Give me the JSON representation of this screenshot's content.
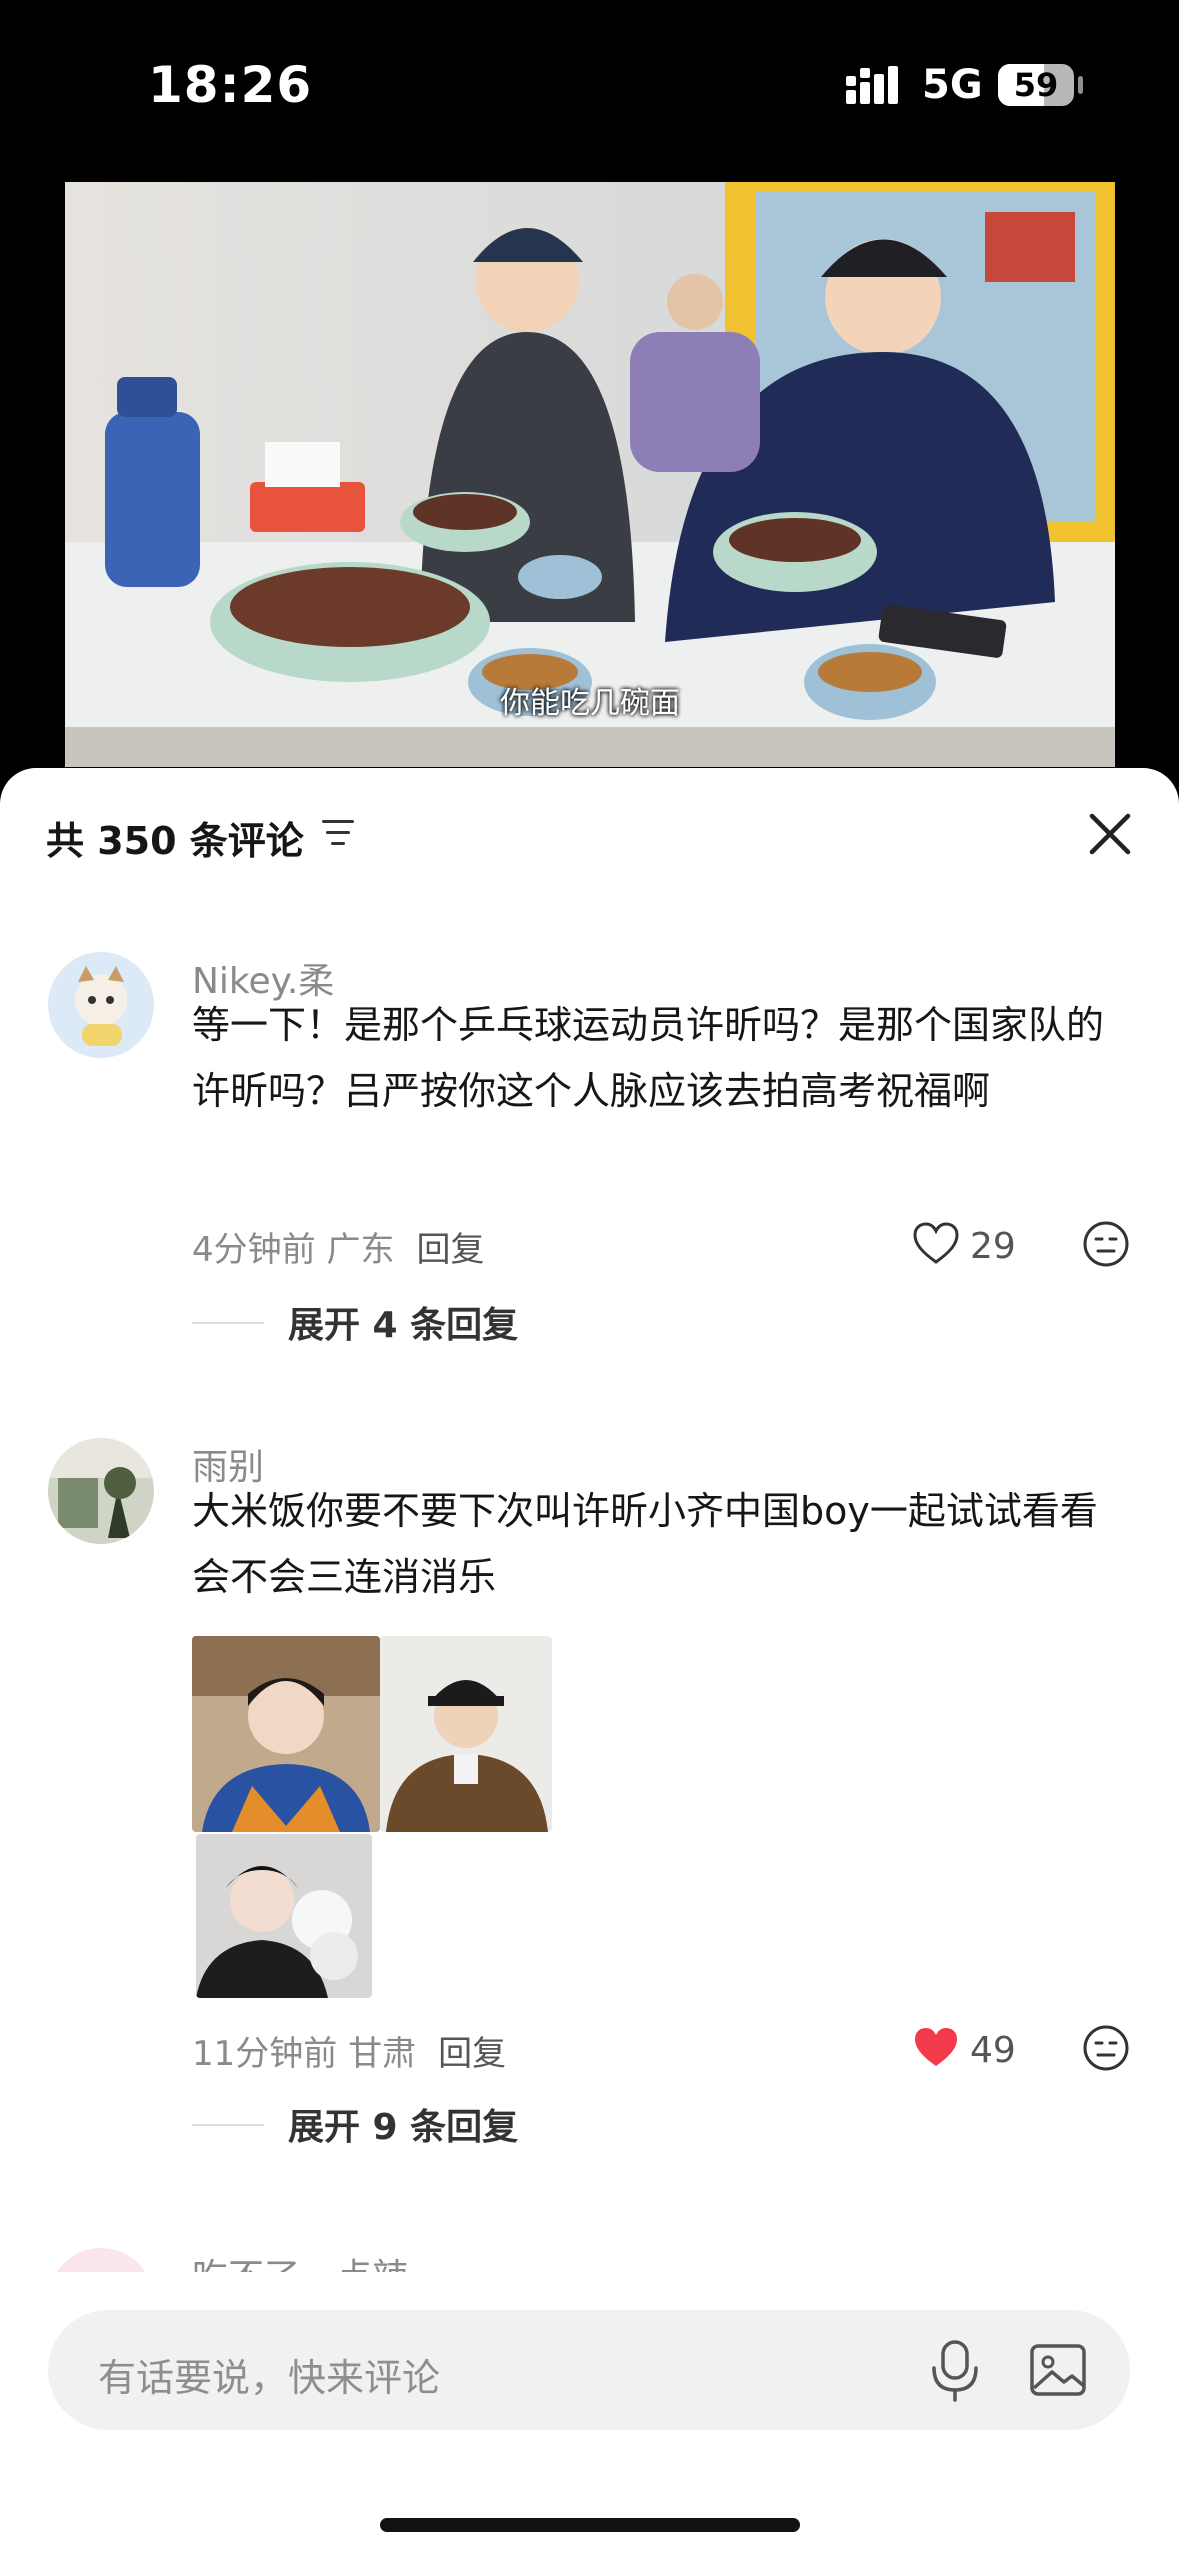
{
  "status_bar": {
    "time": "18:26",
    "network": "5G",
    "battery": "59"
  },
  "video": {
    "subtitle": "你能吃几碗面"
  },
  "comments_panel": {
    "title": "共 350 条评论",
    "comments": [
      {
        "author": "Nikey.柔",
        "text": "等一下！是那个乒乓球运动员许昕吗？是那个国家队的许昕吗？吕严按你这个人脉应该去拍高考祝福啊",
        "time_location": "4分钟前 广东",
        "reply_label": "回复",
        "likes": "29",
        "liked": false,
        "expand_label": "展开 4 条回复"
      },
      {
        "author": "雨别",
        "text": "大米饭你要不要下次叫许昕小齐中国boy一起试试看看会不会三连消消乐",
        "time_location": "11分钟前 甘肃",
        "reply_label": "回复",
        "likes": "49",
        "liked": true,
        "expand_label": "展开 9 条回复"
      },
      {
        "author": "吃不了一点辣"
      }
    ]
  },
  "input": {
    "placeholder": "有话要说，快来评论"
  },
  "colors": {
    "like_red": "#f23a4a",
    "muted": "#8a8a8a",
    "sheet_bg": "#ffffff"
  }
}
